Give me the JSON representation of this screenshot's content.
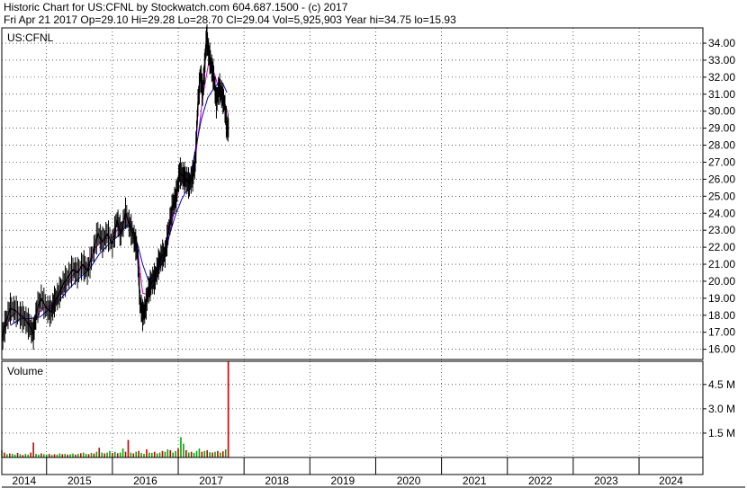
{
  "header": {
    "line1": "Historic Chart for US:CFNL by Stockwatch.com 604.687.1500 - (c) 2017",
    "line2": "Fri Apr 21 2017   Op=29.10  Hi=29.28  Lo=28.70  Cl=29.04  Vol=5,925,903  Year hi=34.75  lo=15.93"
  },
  "colors": {
    "price": "#000000",
    "ma_short": "#cc00cc",
    "ma_long": "#0000cc",
    "vol_up": "#00aa00",
    "vol_down": "#cc0000",
    "grid": "#000000"
  },
  "chart_data": {
    "type": "line",
    "ticker_label": "US:CFNL",
    "price_panel": {
      "ylim": [
        15.4,
        34.9
      ],
      "y_ticks": [
        "34.00",
        "33.00",
        "32.00",
        "31.00",
        "30.00",
        "29.00",
        "28.00",
        "27.00",
        "26.00",
        "25.00",
        "24.00",
        "23.00",
        "22.00",
        "21.00",
        "20.00",
        "19.00",
        "18.00",
        "17.00",
        "16.00"
      ],
      "grid": "dotted",
      "series": [
        {
          "values": [
            [
              2013.82,
              16.5
            ],
            [
              2013.88,
              17.6
            ],
            [
              2013.95,
              18.4
            ],
            [
              2014.02,
              18.3
            ],
            [
              2014.1,
              18.0
            ],
            [
              2014.17,
              17.8
            ],
            [
              2014.24,
              17.4
            ],
            [
              2014.3,
              16.9
            ],
            [
              2014.35,
              18.3
            ],
            [
              2014.42,
              19.0
            ],
            [
              2014.5,
              18.4
            ],
            [
              2014.57,
              18.2
            ],
            [
              2014.62,
              18.8
            ],
            [
              2014.68,
              19.2
            ],
            [
              2014.75,
              19.8
            ],
            [
              2014.82,
              20.2
            ],
            [
              2014.9,
              20.7
            ],
            [
              2014.97,
              20.5
            ],
            [
              2015.05,
              21.0
            ],
            [
              2015.12,
              20.6
            ],
            [
              2015.2,
              21.6
            ],
            [
              2015.28,
              22.8
            ],
            [
              2015.35,
              22.3
            ],
            [
              2015.42,
              22.8
            ],
            [
              2015.5,
              22.2
            ],
            [
              2015.57,
              23.6
            ],
            [
              2015.63,
              22.8
            ],
            [
              2015.7,
              24.0
            ],
            [
              2015.77,
              23.2
            ],
            [
              2015.83,
              22.5
            ],
            [
              2015.88,
              21.8
            ],
            [
              2015.92,
              18.8
            ],
            [
              2015.96,
              18.0
            ],
            [
              2016.0,
              18.4
            ],
            [
              2016.05,
              19.5
            ],
            [
              2016.1,
              20.0
            ],
            [
              2016.15,
              20.2
            ],
            [
              2016.2,
              21.0
            ],
            [
              2016.25,
              21.5
            ],
            [
              2016.3,
              21.6
            ],
            [
              2016.36,
              23.2
            ],
            [
              2016.42,
              24.5
            ],
            [
              2016.47,
              25.0
            ],
            [
              2016.52,
              26.4
            ],
            [
              2016.57,
              26.2
            ],
            [
              2016.62,
              26.0
            ],
            [
              2016.67,
              25.7
            ],
            [
              2016.72,
              26.2
            ],
            [
              2016.76,
              27.0
            ],
            [
              2016.8,
              30.5
            ],
            [
              2016.84,
              32.2
            ],
            [
              2016.87,
              31.0
            ],
            [
              2016.9,
              32.5
            ],
            [
              2016.93,
              34.4
            ],
            [
              2016.96,
              33.5
            ],
            [
              2017.0,
              32.7
            ],
            [
              2017.04,
              32.0
            ],
            [
              2017.08,
              30.5
            ],
            [
              2017.12,
              31.4
            ],
            [
              2017.16,
              31.0
            ],
            [
              2017.2,
              30.5
            ],
            [
              2017.24,
              29.0
            ],
            [
              2017.27,
              29.04
            ]
          ]
        },
        {
          "values": [
            [
              2013.88,
              17.3
            ],
            [
              2013.95,
              17.9
            ],
            [
              2014.05,
              18.2
            ],
            [
              2014.15,
              17.9
            ],
            [
              2014.24,
              17.5
            ],
            [
              2014.32,
              17.6
            ],
            [
              2014.42,
              18.4
            ],
            [
              2014.52,
              18.5
            ],
            [
              2014.62,
              18.7
            ],
            [
              2014.75,
              19.5
            ],
            [
              2014.88,
              20.3
            ],
            [
              2015.0,
              20.7
            ],
            [
              2015.12,
              20.9
            ],
            [
              2015.25,
              22.0
            ],
            [
              2015.38,
              22.5
            ],
            [
              2015.5,
              22.6
            ],
            [
              2015.62,
              23.3
            ],
            [
              2015.72,
              23.8
            ],
            [
              2015.8,
              23.2
            ],
            [
              2015.88,
              22.0
            ],
            [
              2015.96,
              19.3
            ],
            [
              2016.05,
              19.2
            ],
            [
              2016.15,
              20.0
            ],
            [
              2016.25,
              21.0
            ],
            [
              2016.32,
              21.8
            ],
            [
              2016.42,
              23.8
            ],
            [
              2016.52,
              25.6
            ],
            [
              2016.62,
              26.0
            ],
            [
              2016.72,
              26.0
            ],
            [
              2016.8,
              28.5
            ],
            [
              2016.88,
              31.0
            ],
            [
              2016.96,
              32.8
            ],
            [
              2017.05,
              32.2
            ],
            [
              2017.14,
              31.0
            ],
            [
              2017.2,
              30.6
            ],
            [
              2017.26,
              29.8
            ]
          ]
        },
        {
          "values": [
            [
              2013.95,
              17.4
            ],
            [
              2014.1,
              17.8
            ],
            [
              2014.24,
              17.8
            ],
            [
              2014.4,
              17.9
            ],
            [
              2014.55,
              18.4
            ],
            [
              2014.7,
              18.9
            ],
            [
              2014.85,
              19.6
            ],
            [
              2015.0,
              20.2
            ],
            [
              2015.15,
              20.7
            ],
            [
              2015.3,
              21.6
            ],
            [
              2015.45,
              22.2
            ],
            [
              2015.6,
              22.7
            ],
            [
              2015.72,
              23.3
            ],
            [
              2015.8,
              23.2
            ],
            [
              2015.88,
              22.2
            ],
            [
              2015.96,
              21.0
            ],
            [
              2016.05,
              20.0
            ],
            [
              2016.15,
              20.5
            ],
            [
              2016.25,
              21.0
            ],
            [
              2016.35,
              22.5
            ],
            [
              2016.45,
              23.8
            ],
            [
              2016.55,
              24.8
            ],
            [
              2016.65,
              25.5
            ],
            [
              2016.75,
              27.5
            ],
            [
              2016.85,
              29.5
            ],
            [
              2016.95,
              30.8
            ],
            [
              2017.05,
              31.4
            ],
            [
              2017.12,
              31.7
            ],
            [
              2017.18,
              31.6
            ],
            [
              2017.24,
              31.1
            ]
          ]
        }
      ]
    },
    "volume_panel": {
      "label": "Volume",
      "y_ticks": [
        "4.5 M",
        "3.0 M",
        "1.5 M"
      ],
      "ylim": [
        0,
        5.93
      ],
      "bars": [
        [
          2013.82,
          0.45,
          "up"
        ],
        [
          2013.86,
          0.3,
          "down"
        ],
        [
          2013.9,
          0.2,
          "up"
        ],
        [
          2013.94,
          0.25,
          "down"
        ],
        [
          2013.98,
          0.22,
          "up"
        ],
        [
          2014.02,
          0.18,
          "up"
        ],
        [
          2014.06,
          0.28,
          "down"
        ],
        [
          2014.1,
          0.2,
          "up"
        ],
        [
          2014.14,
          0.15,
          "down"
        ],
        [
          2014.18,
          0.22,
          "up"
        ],
        [
          2014.22,
          0.18,
          "up"
        ],
        [
          2014.26,
          0.3,
          "down"
        ],
        [
          2014.3,
          0.92,
          "down"
        ],
        [
          2014.34,
          0.22,
          "up"
        ],
        [
          2014.38,
          0.18,
          "up"
        ],
        [
          2014.42,
          0.25,
          "down"
        ],
        [
          2014.46,
          0.2,
          "up"
        ],
        [
          2014.5,
          0.18,
          "up"
        ],
        [
          2014.54,
          0.22,
          "down"
        ],
        [
          2014.58,
          0.16,
          "up"
        ],
        [
          2014.62,
          0.2,
          "down"
        ],
        [
          2014.66,
          0.18,
          "up"
        ],
        [
          2014.7,
          0.25,
          "up"
        ],
        [
          2014.74,
          0.2,
          "down"
        ],
        [
          2014.78,
          0.22,
          "up"
        ],
        [
          2014.82,
          0.18,
          "down"
        ],
        [
          2014.86,
          0.2,
          "up"
        ],
        [
          2014.9,
          0.24,
          "up"
        ],
        [
          2014.94,
          0.18,
          "down"
        ],
        [
          2014.98,
          0.22,
          "up"
        ],
        [
          2015.02,
          0.26,
          "down"
        ],
        [
          2015.06,
          0.3,
          "up"
        ],
        [
          2015.1,
          0.22,
          "up"
        ],
        [
          2015.14,
          0.2,
          "down"
        ],
        [
          2015.18,
          0.28,
          "up"
        ],
        [
          2015.22,
          0.24,
          "down"
        ],
        [
          2015.26,
          0.35,
          "up"
        ],
        [
          2015.3,
          0.6,
          "down"
        ],
        [
          2015.34,
          0.3,
          "up"
        ],
        [
          2015.38,
          0.25,
          "down"
        ],
        [
          2015.42,
          0.3,
          "up"
        ],
        [
          2015.46,
          0.4,
          "up"
        ],
        [
          2015.5,
          0.28,
          "down"
        ],
        [
          2015.54,
          0.34,
          "up"
        ],
        [
          2015.58,
          0.26,
          "down"
        ],
        [
          2015.62,
          0.3,
          "up"
        ],
        [
          2015.66,
          0.55,
          "up"
        ],
        [
          2015.7,
          0.35,
          "down"
        ],
        [
          2015.74,
          1.08,
          "down"
        ],
        [
          2015.78,
          0.3,
          "up"
        ],
        [
          2015.82,
          0.25,
          "down"
        ],
        [
          2015.86,
          0.35,
          "up"
        ],
        [
          2015.9,
          0.4,
          "down"
        ],
        [
          2015.94,
          0.28,
          "up"
        ],
        [
          2015.98,
          0.22,
          "up"
        ],
        [
          2016.02,
          0.5,
          "down"
        ],
        [
          2016.06,
          0.3,
          "up"
        ],
        [
          2016.1,
          0.28,
          "up"
        ],
        [
          2016.14,
          0.35,
          "down"
        ],
        [
          2016.18,
          0.25,
          "up"
        ],
        [
          2016.22,
          0.3,
          "up"
        ],
        [
          2016.26,
          0.4,
          "down"
        ],
        [
          2016.3,
          0.35,
          "up"
        ],
        [
          2016.34,
          0.5,
          "up"
        ],
        [
          2016.38,
          0.45,
          "down"
        ],
        [
          2016.42,
          0.3,
          "up"
        ],
        [
          2016.46,
          0.4,
          "up"
        ],
        [
          2016.5,
          0.55,
          "down"
        ],
        [
          2016.54,
          1.25,
          "up"
        ],
        [
          2016.58,
          0.85,
          "up"
        ],
        [
          2016.62,
          0.45,
          "down"
        ],
        [
          2016.66,
          0.3,
          "up"
        ],
        [
          2016.7,
          0.35,
          "down"
        ],
        [
          2016.74,
          0.28,
          "up"
        ],
        [
          2016.78,
          0.4,
          "up"
        ],
        [
          2016.82,
          0.55,
          "up"
        ],
        [
          2016.86,
          0.35,
          "down"
        ],
        [
          2016.9,
          0.4,
          "up"
        ],
        [
          2016.94,
          0.45,
          "down"
        ],
        [
          2016.98,
          0.32,
          "up"
        ],
        [
          2017.02,
          0.3,
          "down"
        ],
        [
          2017.06,
          0.35,
          "up"
        ],
        [
          2017.1,
          0.4,
          "down"
        ],
        [
          2017.14,
          0.3,
          "up"
        ],
        [
          2017.18,
          0.38,
          "down"
        ],
        [
          2017.22,
          0.5,
          "up"
        ],
        [
          2017.26,
          5.93,
          "down"
        ]
      ]
    },
    "x_axis": {
      "xlim": [
        2013.82,
        2024.47
      ],
      "tick_labels": [
        "2014",
        "2015",
        "2016",
        "2017",
        "2018",
        "2019",
        "2020",
        "2021",
        "2022",
        "2023",
        "2024"
      ],
      "tick_positions": [
        2014,
        2015,
        2016,
        2017,
        2018,
        2019,
        2020,
        2021,
        2022,
        2023,
        2024
      ]
    }
  }
}
